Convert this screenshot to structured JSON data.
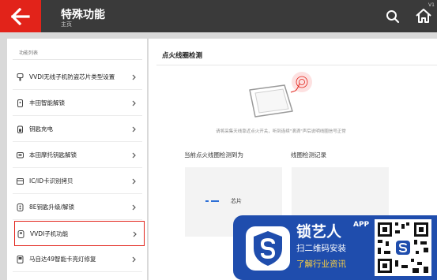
{
  "header": {
    "title": "特殊功能",
    "subtitle": "主页",
    "version": "V1"
  },
  "sidebar": {
    "caption": "功能列表",
    "items": [
      {
        "label": "VVDI无线子机防盗芯片类型设置",
        "icon": "key-icon",
        "selected": false
      },
      {
        "label": "丰田智能解锁",
        "icon": "smart-key-icon",
        "selected": false
      },
      {
        "label": "钥匙充电",
        "icon": "battery-key-icon",
        "selected": false
      },
      {
        "label": "本田摩托钥匙解锁",
        "icon": "remote-key-icon",
        "selected": false
      },
      {
        "label": "IC/ID卡识别拷贝",
        "icon": "card-icon",
        "selected": false
      },
      {
        "label": "8E钥匙升级/解锁",
        "icon": "upgrade-key-icon",
        "selected": false
      },
      {
        "label": "VVDI子机功能",
        "icon": "sub-key-icon",
        "selected": true
      },
      {
        "label": "马自达49智能卡亮灯修复",
        "icon": "smart-card-icon",
        "selected": false
      }
    ]
  },
  "main": {
    "title": "点火线圈检测",
    "hint": "请将采集天线靠近点火开关，听到连续\"滴滴\"声后说明线圈信号正常",
    "detected_label": "当前点火线圈检测到为",
    "record_label": "线圈检测记录",
    "chip_label": "芯片"
  },
  "ad": {
    "brand": "锁艺人",
    "app": "APP",
    "line1": "扫二维码安装",
    "line2": "了解行业资讯"
  },
  "colors": {
    "accent": "#e2231a",
    "header_bg": "#3a3a3a",
    "ad_bg": "#1f4dad",
    "ad_highlight": "#ffd23e",
    "chip_dash": "#2d6fd6"
  }
}
